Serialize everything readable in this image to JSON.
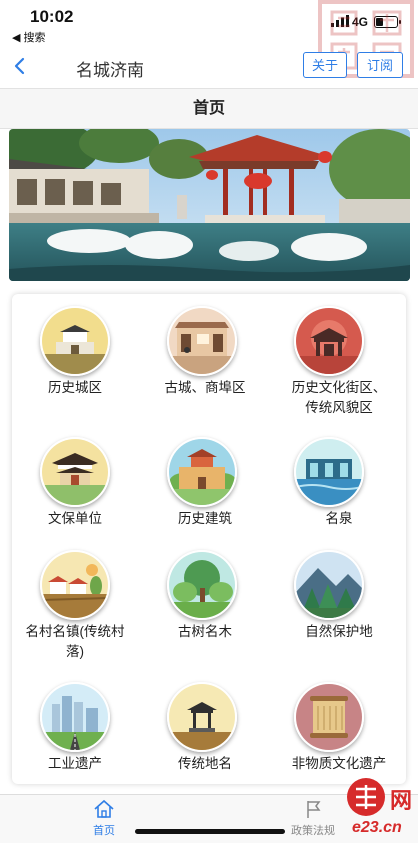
{
  "status": {
    "time": "10:02",
    "back_app": "◀ 搜索",
    "network": "4G",
    "battery_level": 0.35
  },
  "nav": {
    "title": "名城济南",
    "about": "关于",
    "subscribe": "订阅"
  },
  "header": {
    "title": "首页"
  },
  "grid": {
    "items": [
      {
        "label": "历史城区",
        "icon": "city-gate-icon"
      },
      {
        "label": "古城、商埠区",
        "icon": "old-street-icon"
      },
      {
        "label": "历史文化街区、\n传统风貌区",
        "icon": "red-pavilion-icon"
      },
      {
        "label": "文保单位",
        "icon": "temple-icon"
      },
      {
        "label": "历史建筑",
        "icon": "city-wall-icon"
      },
      {
        "label": "名泉",
        "icon": "spring-icon"
      },
      {
        "label": "名村名镇(传统村\n落)",
        "icon": "village-icon"
      },
      {
        "label": "古树名木",
        "icon": "tree-icon"
      },
      {
        "label": "自然保护地",
        "icon": "mountain-forest-icon"
      },
      {
        "label": "工业遗产",
        "icon": "industry-icon"
      },
      {
        "label": "传统地名",
        "icon": "pavilion-icon"
      },
      {
        "label": "非物质文化遗产",
        "icon": "scroll-icon"
      }
    ]
  },
  "tabs": {
    "home": "首页",
    "policy": "政策法规"
  },
  "watermark": {
    "site": "e23.cn",
    "char": "网"
  }
}
